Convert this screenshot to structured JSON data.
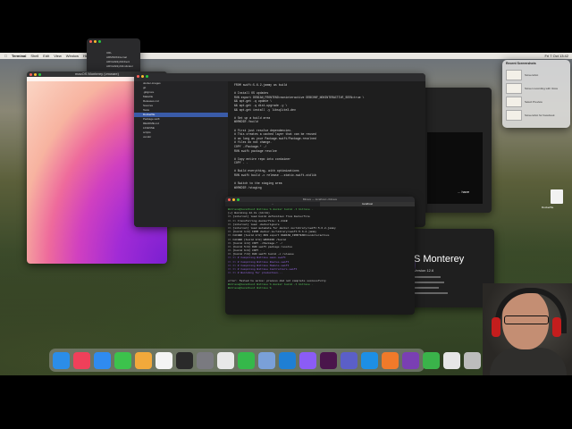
{
  "menubar": {
    "app": "Terminal",
    "items": [
      "Shell",
      "Edit",
      "View",
      "Window",
      "Help"
    ],
    "clock": "Fri 7 Oct 13:42"
  },
  "finder": {
    "items": [
      "URL",
      "ARMSDKInternal",
      "ARVisibilityKitClient",
      "ARVisibilityKitIndicator"
    ]
  },
  "vm": {
    "title": "macOS Monterey (vmware)"
  },
  "xcode": {
    "title": "Dockerfile",
    "nav_items": [
      "docker-images",
      "git",
      ".gitignore",
      "Makefile",
      "Releases.md",
      "Sources",
      "Tests",
      "Dockerfile",
      "Package.swift",
      "README.md",
      "LICENSE",
      "scripts",
      "vendor"
    ],
    "nav_selected": 7,
    "code_lines": [
      "FROM swift:5.6.2-jammy as build",
      "",
      "# Install OS updates",
      "RUN export DEBIAN_FRONTEND=noninteractive DEBCONF_NONINTERACTIVE_SEEN=true \\",
      "    && apt-get -q update \\",
      "    && apt-get -q dist-upgrade -y \\",
      "    && apt-get install -y libsqlite3-dev",
      "",
      "# Set up a build area",
      "WORKDIR /build",
      "",
      "# First just resolve dependencies.",
      "# This creates a cached layer that can be reused",
      "# as long as your Package.swift/Package.resolved",
      "# files do not change.",
      "COPY ./Package.* ./",
      "RUN swift package resolve",
      "",
      "# Copy entire repo into container",
      "COPY . .",
      "",
      "# Build everything, with optimizations",
      "RUN swift build -c release --static-swift-stdlib",
      "",
      "# Switch to the staging area",
      "WORKDIR /staging"
    ]
  },
  "terminal": {
    "title": "Bitrave — localhost:~/bitrave",
    "tabs": [
      "~",
      "localhost"
    ],
    "lines": [
      "Bitrave@localhost Bitrave % docker build -t bitrave .",
      "[+] Building 42.3s (14/18)",
      " => [internal] load build definition from Dockerfile",
      " => => transferring dockerfile: 1.21kB",
      " => [internal] load .dockerignore",
      " => [internal] load metadata for docker.io/library/swift:5.6.2-jammy",
      " => [build 1/8] FROM docker.io/library/swift:5.6.2-jammy",
      " => CACHED [build 2/8] RUN export DEBIAN_FRONTEND=noninteractive",
      " => CACHED [build 3/8] WORKDIR /build",
      " => [build 4/8] COPY ./Package.* ./",
      " => [build 5/8] RUN swift package resolve",
      " => [build 6/8] COPY . .",
      " => [build 7/8] RUN swift build -c release",
      " => => # Compiling Bitrave main.swift",
      " => => # Compiling Bitrave Routes.swift",
      " => => # Compiling Bitrave Models.swift",
      " => => # Compiling Bitrave Controllers.swift",
      " => => # Building for production...",
      "",
      "error: failed to solve: process did not complete successfully",
      "Bitrave@localhost Bitrave % docker build -t bitrave .",
      "Bitrave@localhost Bitrave % "
    ]
  },
  "about": {
    "title": "S Monterey",
    "version": "Version 12.6"
  },
  "smallwin": {
    "text": "... have"
  },
  "notification": {
    "header": "Recent Screenshots",
    "items": [
      "Screenshot",
      "Screen recording with Voice",
      "Select Preview",
      "Screenshot for Facebook"
    ]
  },
  "desktop_file": {
    "label": "Dockerfile"
  },
  "dock": {
    "apps": [
      {
        "name": "finder",
        "color": "#2b8de8"
      },
      {
        "name": "music",
        "color": "#f0405a"
      },
      {
        "name": "safari",
        "color": "#2f8bf0"
      },
      {
        "name": "messages",
        "color": "#3cc24c"
      },
      {
        "name": "photos",
        "color": "#f2a93b"
      },
      {
        "name": "calendar",
        "color": "#f4f4f4"
      },
      {
        "name": "terminal",
        "color": "#2a2a2a"
      },
      {
        "name": "system-preferences",
        "color": "#7a7a80"
      },
      {
        "name": "activity-monitor",
        "color": "#e8e8e8"
      },
      {
        "name": "numbers",
        "color": "#35b84a"
      },
      {
        "name": "preview",
        "color": "#7aa0d8"
      },
      {
        "name": "vscode",
        "color": "#1f7fd4"
      },
      {
        "name": "github-desktop",
        "color": "#8b5cf6"
      },
      {
        "name": "slack",
        "color": "#4a154b"
      },
      {
        "name": "teams",
        "color": "#5b5fc7"
      },
      {
        "name": "docker",
        "color": "#1d8fe6"
      },
      {
        "name": "keynote",
        "color": "#f07a2a"
      },
      {
        "name": "tor-browser",
        "color": "#7a3fb3"
      },
      {
        "name": "downloads",
        "color": "#3ab34a"
      },
      {
        "name": "documents",
        "color": "#e6e6e6"
      },
      {
        "name": "trash",
        "color": "#bcbcbc"
      }
    ]
  }
}
